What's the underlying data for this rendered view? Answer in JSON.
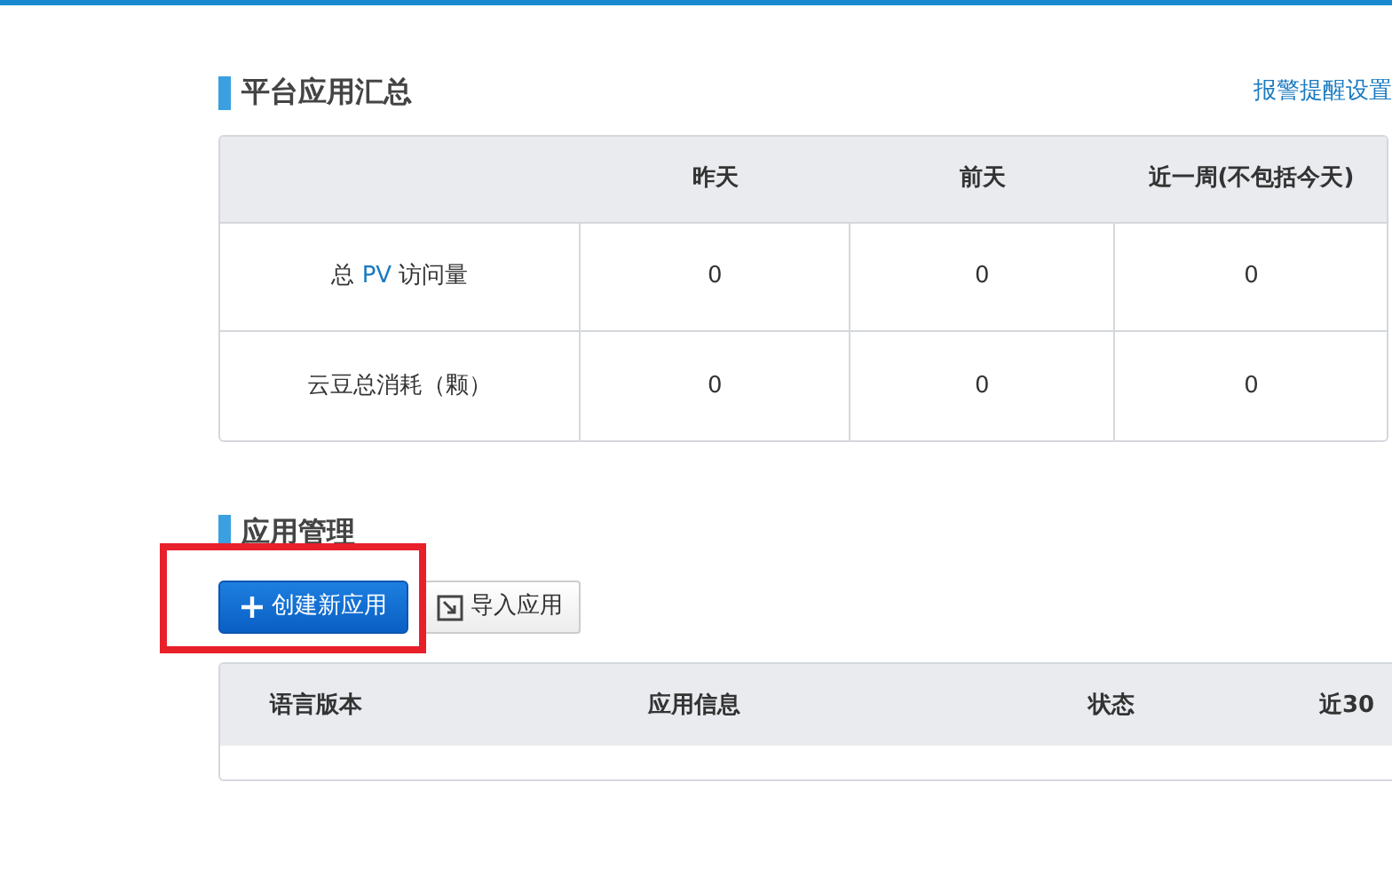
{
  "summary": {
    "title": "平台应用汇总",
    "alert_link": "报警提醒设置",
    "columns": [
      "",
      "昨天",
      "前天",
      "近一周(不包括今天)"
    ],
    "rows": [
      {
        "label_parts": [
          {
            "text": "总 ",
            "kind": "plain"
          },
          {
            "text": "PV",
            "kind": "accent"
          },
          {
            "text": " 访问量",
            "kind": "plain"
          }
        ],
        "values": [
          "0",
          "0",
          "0"
        ]
      },
      {
        "label_parts": [
          {
            "text": "云豆总消耗（颗）",
            "kind": "plain"
          }
        ],
        "values": [
          "0",
          "0",
          "0"
        ]
      }
    ]
  },
  "apps": {
    "title": "应用管理",
    "buttons": [
      {
        "label": "创建新应用",
        "kind": "primary",
        "highlighted": true
      },
      {
        "label": "导入应用",
        "kind": "secondary",
        "highlighted": false
      }
    ],
    "columns": [
      "语言版本",
      "应用信息",
      "状态",
      "近30"
    ]
  }
}
